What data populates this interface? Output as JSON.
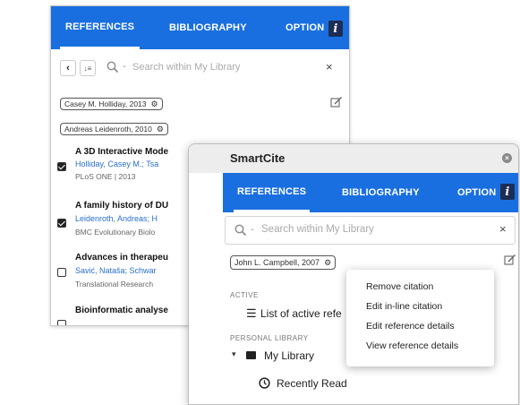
{
  "back_panel": {
    "tabs": [
      "REFERENCES",
      "BIBLIOGRAPHY",
      "OPTION"
    ],
    "info_label": "i",
    "search_placeholder": "Search within My Library",
    "clear_label": "×",
    "sort_label": "↓≡",
    "chips": [
      "Casey M. Holliday, 2013",
      "Andreas Leidenroth, 2010"
    ],
    "references": [
      {
        "title": "A 3D Interactive Mode",
        "authors": "Holliday, Casey M.;  Tsa",
        "source": "PLoS ONE | 2013",
        "checked": true
      },
      {
        "title": "A family history of DU",
        "authors": "Leidenroth, Andreas;  H",
        "source": "BMC Evolutionary Biolo",
        "checked": true
      },
      {
        "title": "Advances in therapeu",
        "authors": "Savić, Nataša;  Schwar",
        "source": "Translational Research",
        "checked": false
      },
      {
        "title": "Bioinformatic analyse",
        "authors": "",
        "source": "",
        "checked": false
      }
    ]
  },
  "front_panel": {
    "title": "SmartCite",
    "tabs": [
      "REFERENCES",
      "BIBLIOGRAPHY",
      "OPTION"
    ],
    "info_label": "i",
    "search_placeholder": "Search within My Library",
    "clear_label": "×",
    "chip": "John L. Campbell, 2007",
    "active_label": "ACTIVE",
    "active_item": "List of active refe",
    "library_label": "PERSONAL LIBRARY",
    "my_library": "My Library",
    "recently_read": "Recently Read",
    "context_menu": [
      "Remove citation",
      "Edit in-line citation",
      "Edit reference details",
      "View reference details"
    ]
  }
}
